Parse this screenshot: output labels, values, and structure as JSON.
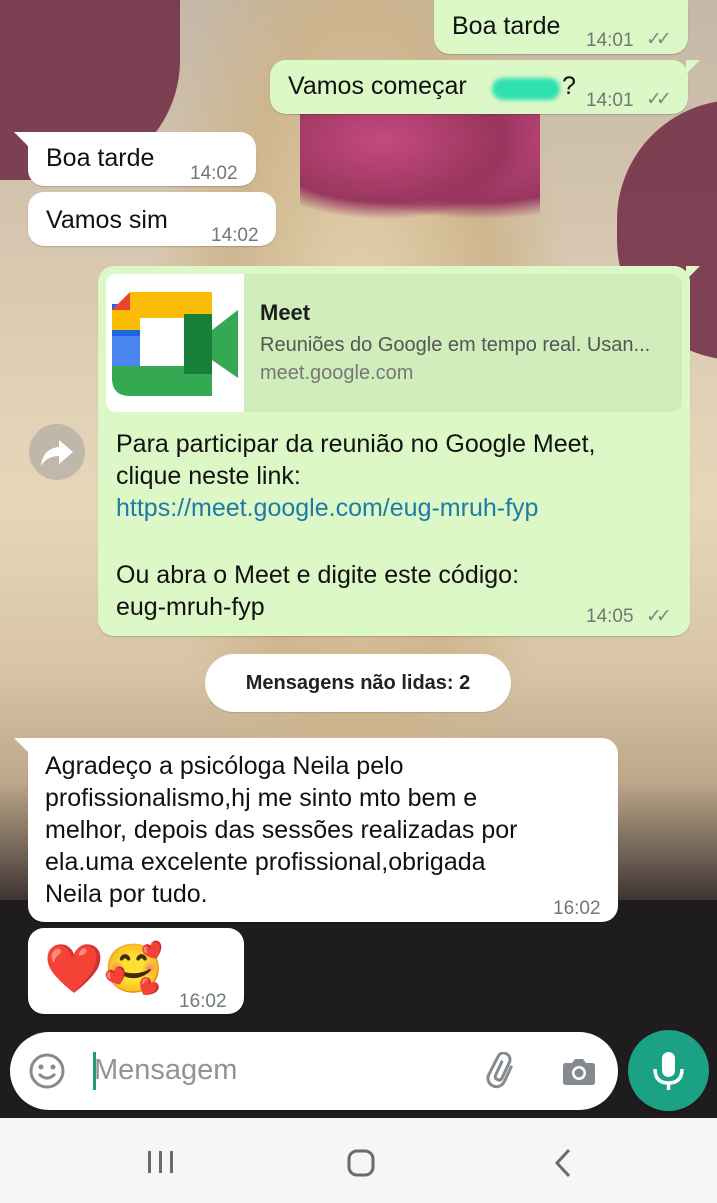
{
  "messages": [
    {
      "text": "Boa tarde",
      "time": "14:01",
      "status": "read"
    },
    {
      "text": "Vamos começar",
      "text_end": "?",
      "time": "14:01",
      "status": "read"
    },
    {
      "text": "Boa tarde",
      "time": "14:02"
    },
    {
      "text": "Vamos sim",
      "time": "14:02"
    },
    {
      "link_preview": {
        "title": "Meet",
        "description": "Reuniões do Google em tempo real. Usan...",
        "domain": "meet.google.com"
      },
      "line1": "Para participar da reunião no Google Meet,",
      "line2": "clique neste link:",
      "url": "https://meet.google.com/eug-mruh-fyp",
      "line3": "Ou abra o Meet e digite este código:",
      "line4": "eug-mruh-fyp",
      "time": "14:05",
      "status": "read"
    },
    {
      "lines": [
        "Agradeço a psicóloga Neila pelo",
        "profissionalismo,hj me sinto mto bem e",
        "melhor, depois das sessões realizadas por",
        "ela.uma excelente profissional,obrigada",
        "Neila por tudo."
      ],
      "time": "16:02"
    },
    {
      "emoji": "❤️🥰",
      "time": "16:02"
    }
  ],
  "unread_banner": "Mensagens não lidas: 2",
  "composer": {
    "placeholder": "Mensagem"
  },
  "icons": {
    "read_ticks": "✓✓",
    "emoji": "emoji-icon",
    "attach": "paperclip-icon",
    "camera": "camera-icon",
    "mic": "mic-icon",
    "forward": "forward-icon"
  },
  "colors": {
    "outgoing_bubble": "#dcf8c6",
    "incoming_bubble": "#ffffff",
    "link": "#1f7aa8",
    "accent": "#1ba183"
  }
}
